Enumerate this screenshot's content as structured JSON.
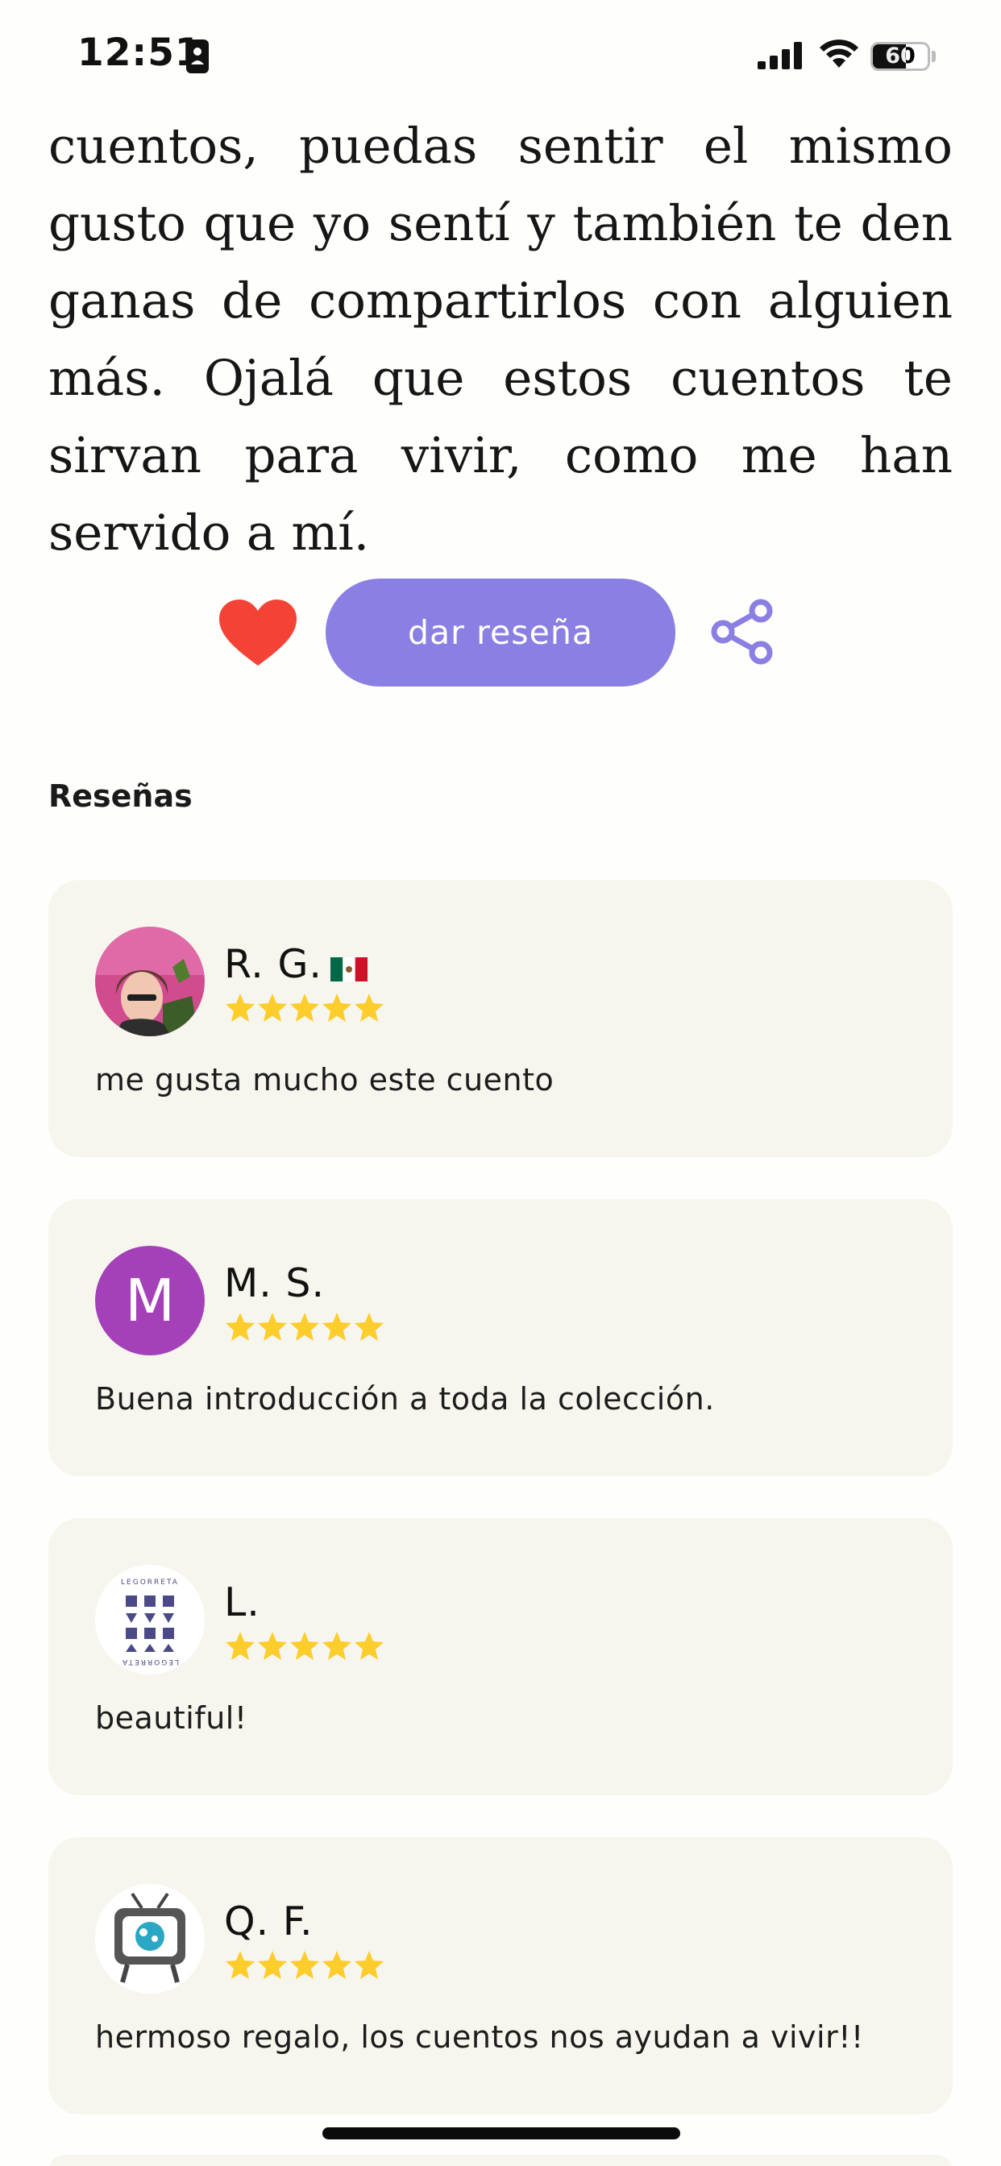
{
  "status_bar": {
    "time": "12:51",
    "battery": "60",
    "battery_level": 0.6,
    "icons": [
      "id-card-icon",
      "signal-icon",
      "wifi-icon",
      "battery-icon"
    ]
  },
  "story": {
    "text": "cuentos, puedas sentir el mismo gusto que yo sentí y también te den ganas de compartirlos con alguien más. Ojalá que estos cuentos te sirvan para vivir, como me han servido a mí."
  },
  "actions": {
    "heart_icon": "heart-icon",
    "review_button": "dar reseña",
    "share_icon": "share-icon",
    "accent_color": "#8a7fe2",
    "heart_color": "#f44336"
  },
  "reviews": {
    "heading": "Reseñas",
    "items": [
      {
        "name": "R. G.",
        "flag": "mexico-flag-icon",
        "rating": 5,
        "text": "me gusta mucho este cuento",
        "avatar": "photo-avatar"
      },
      {
        "name": "M. S.",
        "initial": "M",
        "rating": 5,
        "text": "Buena introducción a toda la colección.",
        "avatar": "initial-avatar",
        "avatar_color": "#a441b8"
      },
      {
        "name": "L.",
        "rating": 5,
        "text": "beautiful!",
        "avatar": "logo-avatar",
        "logo_text": "LEGORRETA"
      },
      {
        "name": "Q. F.",
        "rating": 5,
        "text": "hermoso regalo, los cuentos nos ayudan a vivir!!",
        "avatar": "tv-avatar"
      }
    ]
  }
}
